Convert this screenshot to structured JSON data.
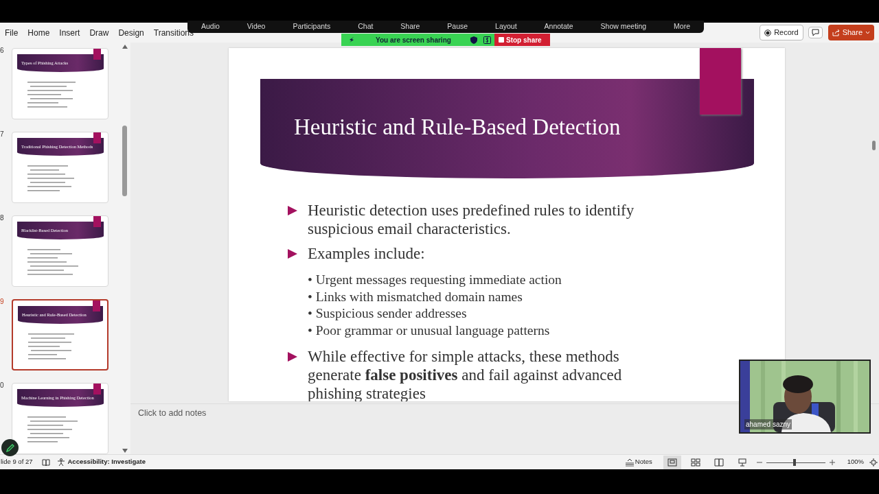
{
  "zoom_toolbar": {
    "items": [
      "Audio",
      "Video",
      "Participants",
      "Chat",
      "Share",
      "Pause",
      "Layout",
      "Annotate",
      "Show meeting",
      "More"
    ]
  },
  "sharing_banner": {
    "text": "You are screen sharing",
    "stop_label": "Stop share"
  },
  "ribbon": {
    "tabs": [
      {
        "label": "File",
        "selected": false
      },
      {
        "label": "Home",
        "selected": false
      },
      {
        "label": "Insert",
        "selected": false
      },
      {
        "label": "Draw",
        "selected": false
      },
      {
        "label": "Design",
        "selected": false
      },
      {
        "label": "Transitions",
        "selected": false
      }
    ],
    "record_label": "Record",
    "share_label": "Share"
  },
  "thumbnails": [
    {
      "number": "6",
      "title": "Types of Phishing Attacks",
      "selected": false
    },
    {
      "number": "7",
      "title": "Traditional Phishing Detection Methods",
      "selected": false
    },
    {
      "number": "8",
      "title": "Blacklist-Based Detection",
      "selected": false
    },
    {
      "number": "9",
      "title": "Heuristic and Rule-Based Detection",
      "selected": true
    },
    {
      "number": "0",
      "title": "Machine Learning in Phishing Detection",
      "selected": false
    }
  ],
  "slide": {
    "title": "Heuristic and Rule-Based Detection",
    "bullets": [
      {
        "kind": "main",
        "text": "Heuristic detection uses predefined rules to identify suspicious email characteristics."
      },
      {
        "kind": "main",
        "text": "Examples include:"
      },
      {
        "kind": "sub",
        "text": "• Urgent messages requesting immediate action"
      },
      {
        "kind": "sub",
        "text": "• Links with mismatched domain names"
      },
      {
        "kind": "sub",
        "text": "• Suspicious sender addresses"
      },
      {
        "kind": "sub",
        "text": "• Poor grammar or unusual language patterns"
      },
      {
        "kind": "main",
        "text": "While effective for simple attacks, these methods generate **false positives** and fail against advanced phishing strategies"
      }
    ]
  },
  "notes": {
    "placeholder": "Click to add notes"
  },
  "video": {
    "name": "ahamed sazny"
  },
  "status_bar": {
    "slide_info": "lide 9 of 27",
    "accessibility": "Accessibility: Investigate",
    "notes_label": "Notes",
    "zoom_text": "100%",
    "zoom_slider": {
      "level": 0.48
    }
  }
}
